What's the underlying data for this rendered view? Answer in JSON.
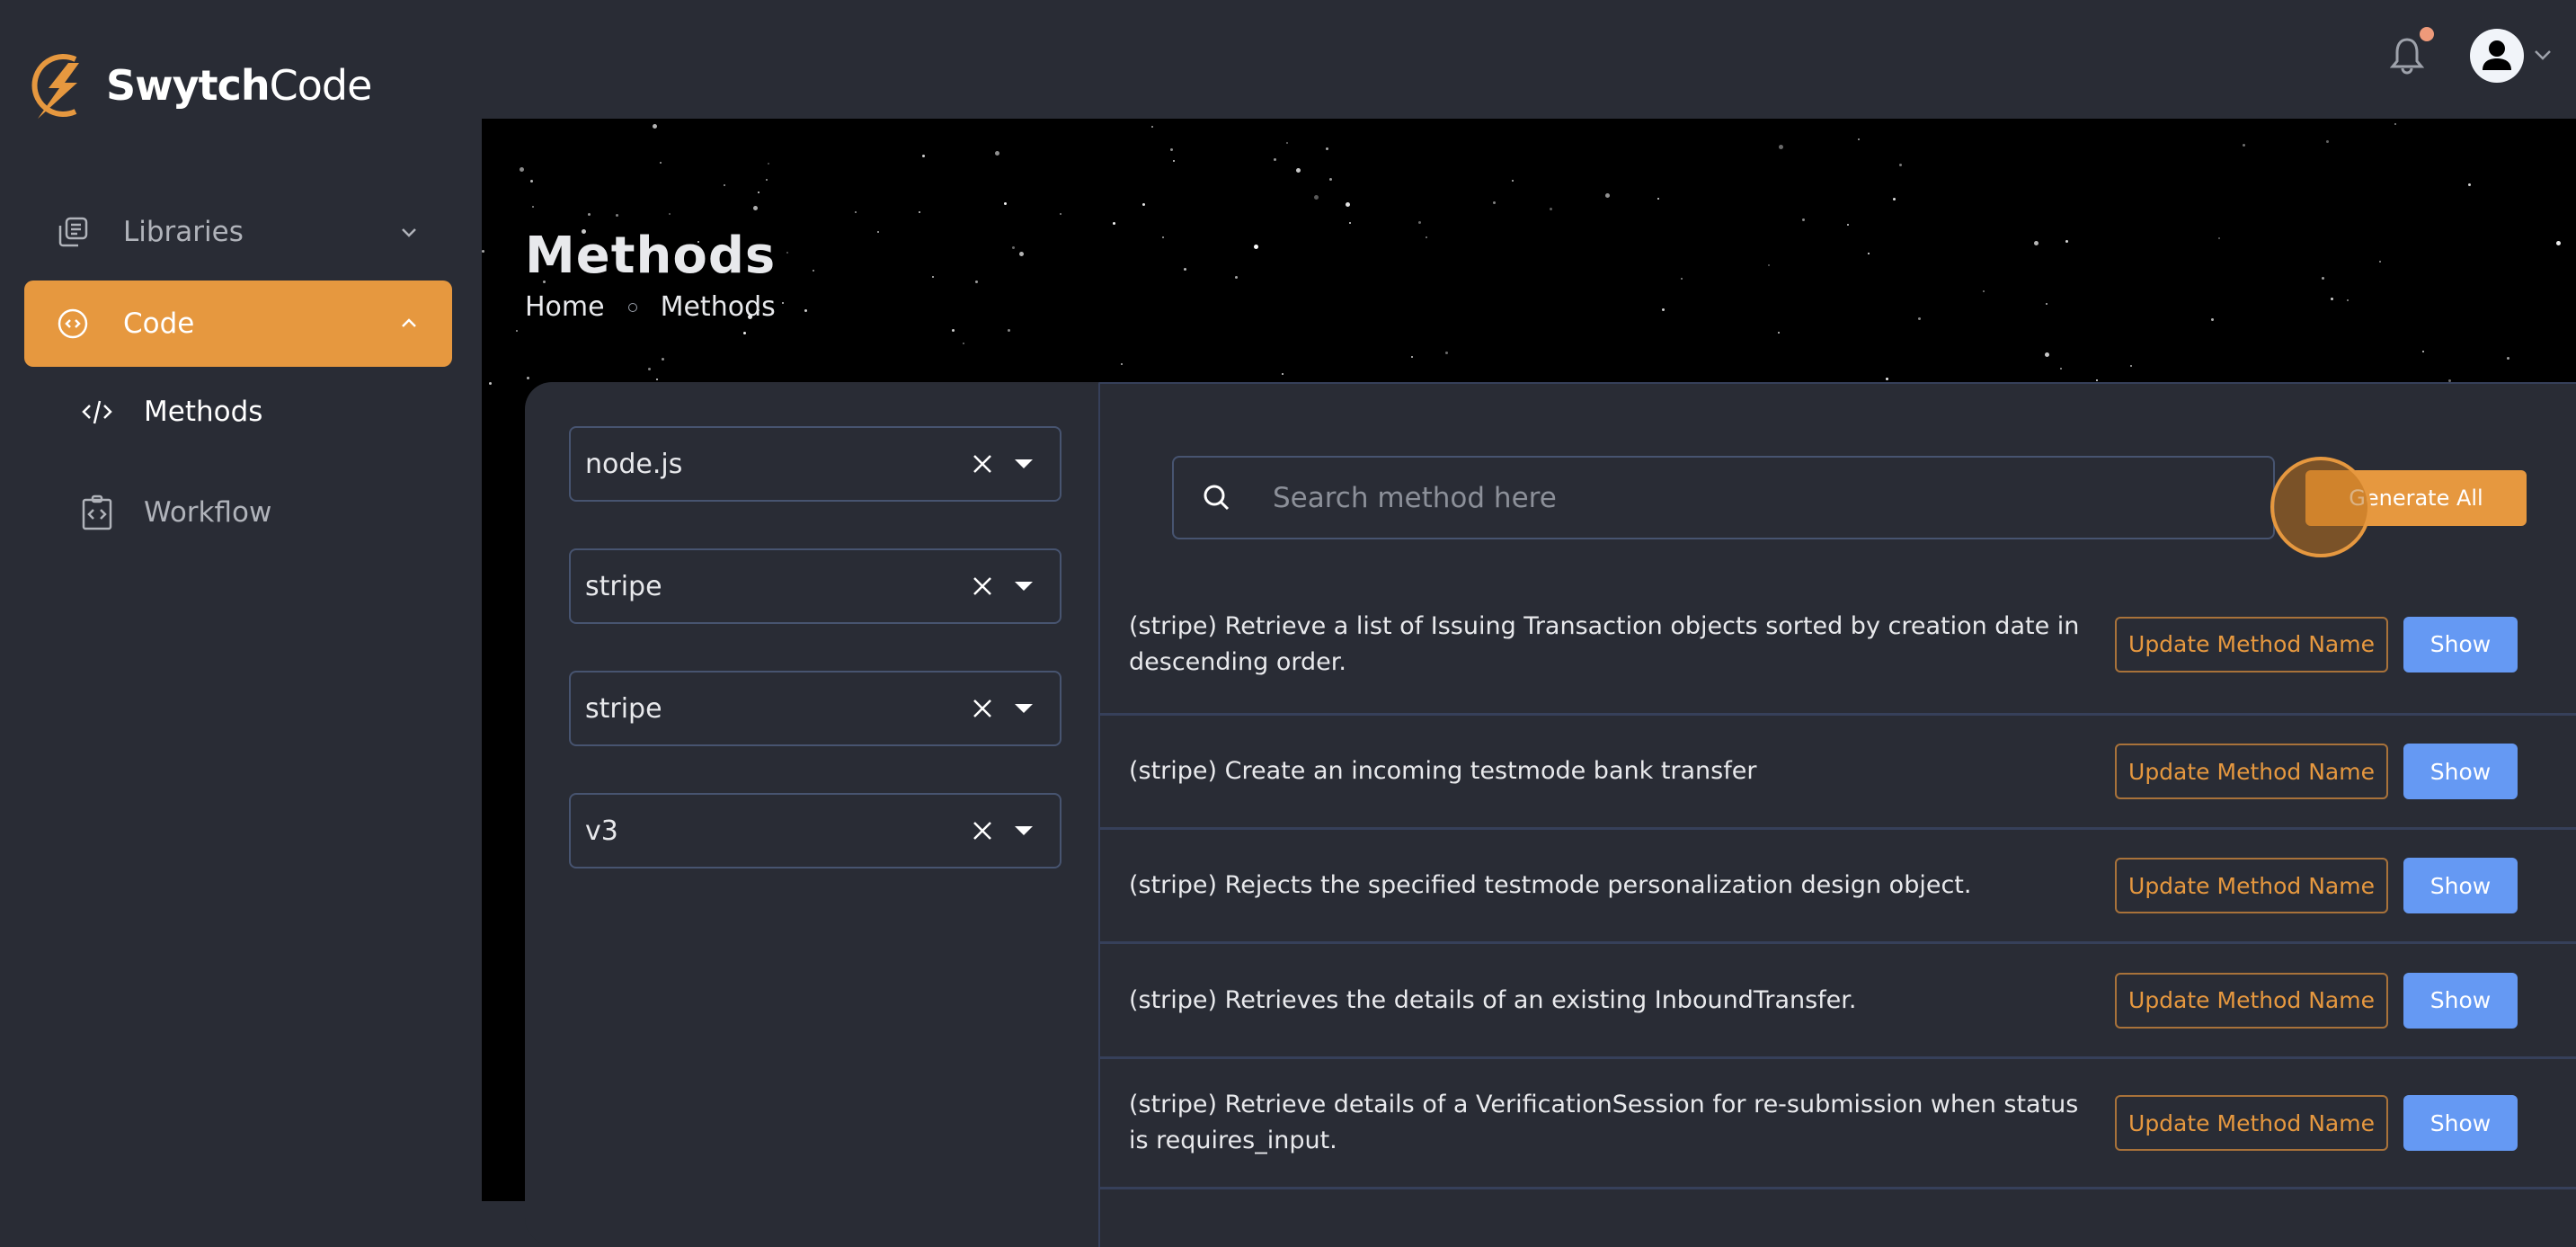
{
  "brand": {
    "name_bold": "Swytch",
    "name_light": "Code",
    "accent": "#e6983f"
  },
  "sidebar": {
    "items": [
      {
        "label": "Libraries",
        "icon": "library-icon",
        "expanded": false
      },
      {
        "label": "Code",
        "icon": "code-circle-icon",
        "expanded": true,
        "active": true
      }
    ],
    "sub_items": [
      {
        "label": "Methods",
        "icon": "code-tag-icon",
        "active": true
      },
      {
        "label": "Workflow",
        "icon": "clipboard-code-icon"
      }
    ]
  },
  "topbar": {
    "notification_badge": true,
    "avatar_icon": "user-icon"
  },
  "page": {
    "title": "Methods",
    "breadcrumb": [
      "Home",
      "Methods"
    ]
  },
  "filters": [
    {
      "value": "node.js"
    },
    {
      "value": "stripe"
    },
    {
      "value": "stripe"
    },
    {
      "value": "v3"
    }
  ],
  "search": {
    "placeholder": "Search method here",
    "value": ""
  },
  "toolbar": {
    "generate_all_label": "Generate All"
  },
  "methods": [
    {
      "description": "(stripe) Retrieve a list of Issuing Transaction objects sorted by creation date in descending order.",
      "update_label": "Update Method Name",
      "show_label": "Show"
    },
    {
      "description": "(stripe) Create an incoming testmode bank transfer",
      "update_label": "Update Method Name",
      "show_label": "Show"
    },
    {
      "description": "(stripe) Rejects the specified testmode personalization design object.",
      "update_label": "Update Method Name",
      "show_label": "Show"
    },
    {
      "description": "(stripe) Retrieves the details of an existing InboundTransfer.",
      "update_label": "Update Method Name",
      "show_label": "Show"
    },
    {
      "description": "(stripe) Retrieve details of a VerificationSession for re-submission when status is requires_input.",
      "update_label": "Update Method Name",
      "show_label": "Show"
    }
  ],
  "colors": {
    "accent": "#e6983f",
    "show_button": "#6599f3",
    "background": "#292c35",
    "hero": "#000000",
    "notification": "#ee9a7a"
  }
}
